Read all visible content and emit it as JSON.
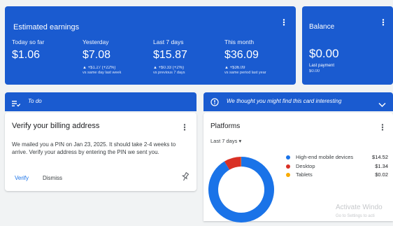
{
  "earnings": {
    "title": "Estimated earnings",
    "metrics": [
      {
        "label": "Today so far",
        "value": "$1.06",
        "change": "",
        "compare": ""
      },
      {
        "label": "Yesterday",
        "value": "$7.08",
        "change": "▲ +$1.27 (+22%)",
        "compare": "vs same day last week"
      },
      {
        "label": "Last 7 days",
        "value": "$15.87",
        "change": "▲ +$0.33 (+2%)",
        "compare": "vs previous 7 days"
      },
      {
        "label": "This month",
        "value": "$36.09",
        "change": "▲ +$36.09",
        "compare": "vs same period last year"
      }
    ]
  },
  "balance": {
    "title": "Balance",
    "value": "$0.00",
    "last_payment_label": "Last payment",
    "last_payment_value": "$0.00"
  },
  "todo": {
    "header": "To do",
    "card_title": "Verify your billing address",
    "body": "We mailed you a PIN on Jan 23, 2025. It should take 2-4 weeks to arrive. Verify your address by entering the PIN we sent you.",
    "verify_label": "Verify",
    "dismiss_label": "Dismiss"
  },
  "suggestion": {
    "header": "We thought you might find this card interesting"
  },
  "platforms": {
    "title": "Platforms",
    "range": "Last 7 days ▾",
    "legend": [
      {
        "name": "High-end mobile devices",
        "amount": "$14.52",
        "color": "#1a73e8"
      },
      {
        "name": "Desktop",
        "amount": "$1.34",
        "color": "#d93025"
      },
      {
        "name": "Tablets",
        "amount": "$0.02",
        "color": "#f9ab00"
      }
    ]
  },
  "chart_data": {
    "type": "pie",
    "categories": [
      "High-end mobile devices",
      "Desktop",
      "Tablets"
    ],
    "values": [
      14.52,
      1.34,
      0.02
    ],
    "colors": [
      "#1a73e8",
      "#d93025",
      "#f9ab00"
    ],
    "title": "Platforms"
  },
  "watermark": {
    "line1": "Activate Windo",
    "line2": "Go to Settings to acti"
  }
}
